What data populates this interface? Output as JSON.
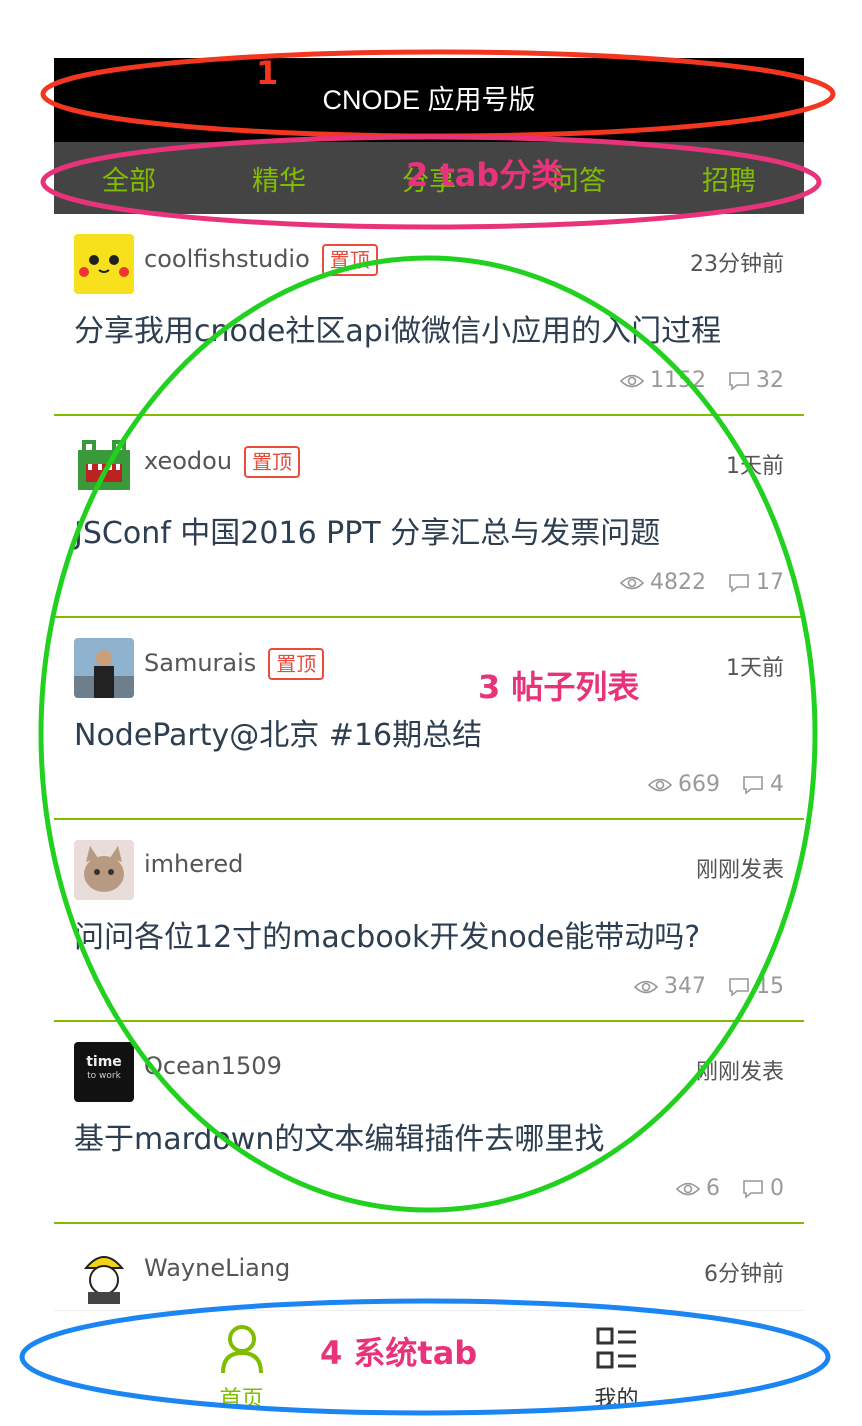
{
  "header": {
    "title": "CNODE 应用号版"
  },
  "tabs": [
    "全部",
    "精华",
    "分享",
    "问答",
    "招聘"
  ],
  "topics": [
    {
      "author": "coolfishstudio",
      "pinned": true,
      "pin_label": "置顶",
      "time": "23分钟前",
      "title": "分享我用cnode社区api做微信小应用的入门过程",
      "views": "1152",
      "replies": "32"
    },
    {
      "author": "xeodou",
      "pinned": true,
      "pin_label": "置顶",
      "time": "1天前",
      "title": "JSConf 中国2016 PPT 分享汇总与发票问题",
      "views": "4822",
      "replies": "17"
    },
    {
      "author": "Samurais",
      "pinned": true,
      "pin_label": "置顶",
      "time": "1天前",
      "title": "NodeParty@北京 #16期总结",
      "views": "669",
      "replies": "4"
    },
    {
      "author": "imhered",
      "pinned": false,
      "time": "刚刚发表",
      "title": "问问各位12寸的macbook开发node能带动吗?",
      "views": "347",
      "replies": "15"
    },
    {
      "author": "Ocean1509",
      "pinned": false,
      "time": "刚刚发表",
      "title": "基于mardown的文本编辑插件去哪里找",
      "views": "6",
      "replies": "0"
    },
    {
      "author": "WayneLiang",
      "pinned": false,
      "time": "6分钟前",
      "title": "",
      "views": "",
      "replies": ""
    }
  ],
  "footer": {
    "home_label": "首页",
    "mine_label": "我的"
  },
  "annotations": {
    "a1": "1",
    "a2": "2 tab分类",
    "a3": "3 帖子列表",
    "a4": "4 系统tab"
  },
  "colors": {
    "accent": "#80bd01",
    "pin": "#e74c3c",
    "header_bg": "#000000",
    "tabs_bg": "#444444"
  }
}
